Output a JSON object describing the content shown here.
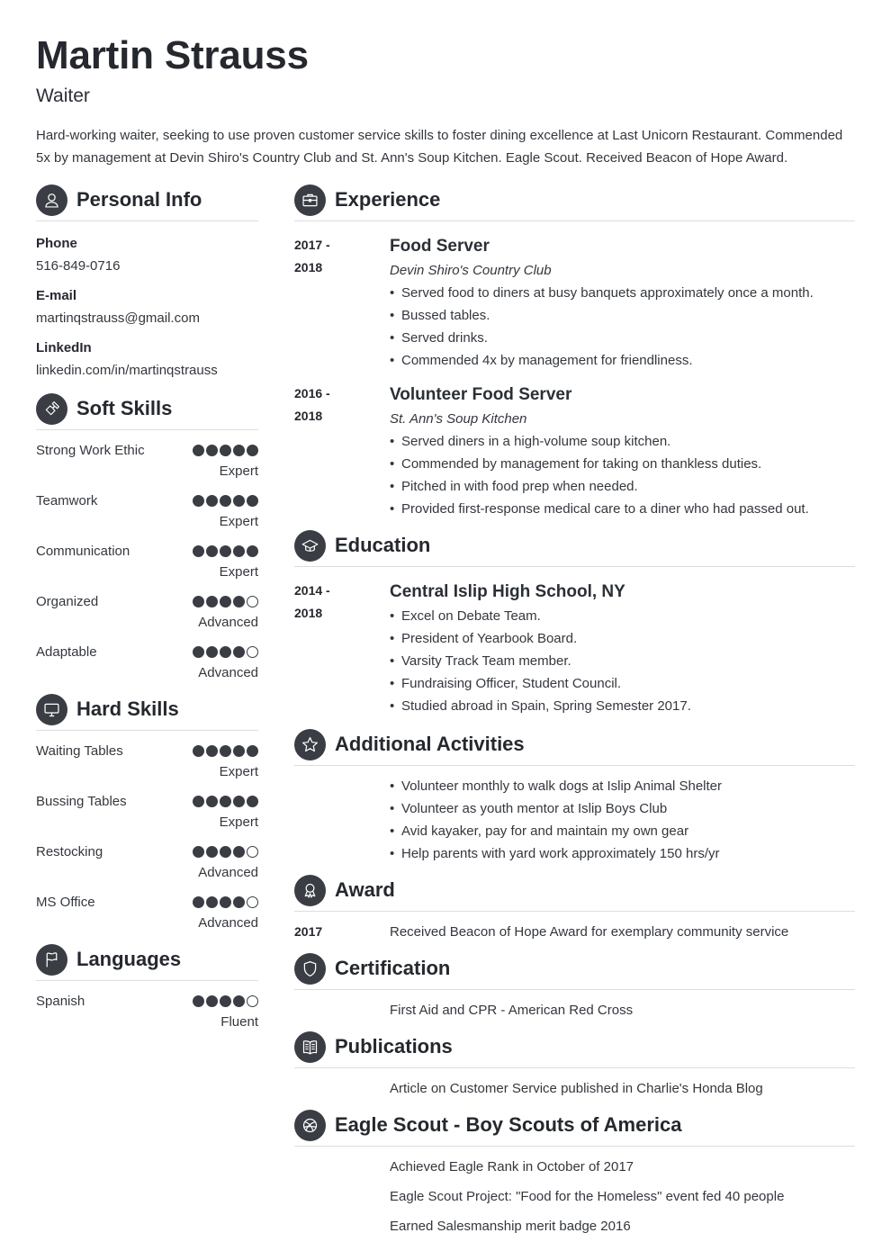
{
  "header": {
    "name": "Martin Strauss",
    "title": "Waiter",
    "summary": "Hard-working waiter, seeking to use proven customer service skills to foster dining excellence at Last Unicorn Restaurant. Commended 5x by management at Devin Shiro's Country Club and St. Ann's Soup Kitchen. Eagle Scout. Received Beacon of Hope Award."
  },
  "personal_info": {
    "heading": "Personal Info",
    "icon": "person-icon",
    "fields": [
      {
        "label": "Phone",
        "value": "516-849-0716"
      },
      {
        "label": "E-mail",
        "value": "martinqstrauss@gmail.com"
      },
      {
        "label": "LinkedIn",
        "value": "linkedin.com/in/martinqstrauss"
      }
    ]
  },
  "soft_skills": {
    "heading": "Soft Skills",
    "icon": "puzzle-icon",
    "items": [
      {
        "name": "Strong Work Ethic",
        "rating": 5,
        "max": 5,
        "level": "Expert"
      },
      {
        "name": "Teamwork",
        "rating": 5,
        "max": 5,
        "level": "Expert"
      },
      {
        "name": "Communication",
        "rating": 5,
        "max": 5,
        "level": "Expert"
      },
      {
        "name": "Organized",
        "rating": 4,
        "max": 5,
        "level": "Advanced"
      },
      {
        "name": "Adaptable",
        "rating": 4,
        "max": 5,
        "level": "Advanced"
      }
    ]
  },
  "hard_skills": {
    "heading": "Hard Skills",
    "icon": "monitor-icon",
    "items": [
      {
        "name": "Waiting Tables",
        "rating": 5,
        "max": 5,
        "level": "Expert"
      },
      {
        "name": "Bussing Tables",
        "rating": 5,
        "max": 5,
        "level": "Expert"
      },
      {
        "name": "Restocking",
        "rating": 4,
        "max": 5,
        "level": "Advanced"
      },
      {
        "name": "MS Office",
        "rating": 4,
        "max": 5,
        "level": "Advanced"
      }
    ]
  },
  "languages": {
    "heading": "Languages",
    "icon": "flag-icon",
    "items": [
      {
        "name": "Spanish",
        "rating": 4,
        "max": 5,
        "level": "Fluent"
      }
    ]
  },
  "experience": {
    "heading": "Experience",
    "icon": "briefcase-icon",
    "entries": [
      {
        "date_start": "2017 -",
        "date_end": "2018",
        "title": "Food Server",
        "company": "Devin Shiro's Country Club",
        "bullets": [
          "Served food to diners at busy banquets approximately once a month.",
          "Bussed tables.",
          "Served drinks.",
          "Commended 4x by management for friendliness."
        ]
      },
      {
        "date_start": "2016 -",
        "date_end": "2018",
        "title": "Volunteer Food Server",
        "company": "St. Ann's Soup Kitchen",
        "bullets": [
          "Served diners in a high-volume soup kitchen.",
          "Commended by management for taking on thankless duties.",
          "Pitched in with food prep when needed.",
          "Provided first-response medical care to a diner who had passed out."
        ]
      }
    ]
  },
  "education": {
    "heading": "Education",
    "icon": "graduation-cap-icon",
    "entries": [
      {
        "date_start": "2014 -",
        "date_end": "2018",
        "title": "Central Islip High School, NY",
        "bullets": [
          "Excel on Debate Team.",
          "President of Yearbook Board.",
          "Varsity Track Team member.",
          "Fundraising Officer, Student Council.",
          "Studied abroad in Spain, Spring Semester 2017."
        ]
      }
    ]
  },
  "activities": {
    "heading": "Additional Activities",
    "icon": "star-icon",
    "bullets": [
      "Volunteer monthly to walk dogs at Islip Animal Shelter",
      "Volunteer as youth mentor at Islip Boys Club",
      "Avid kayaker, pay for and maintain my own gear",
      "Help parents with yard work approximately 150 hrs/yr"
    ]
  },
  "award": {
    "heading": "Award",
    "icon": "award-ribbon-icon",
    "date": "2017",
    "text": "Received Beacon of Hope Award for exemplary community service"
  },
  "certification": {
    "heading": "Certification",
    "icon": "shield-icon",
    "text": "First Aid and CPR - American Red Cross"
  },
  "publications": {
    "heading": "Publications",
    "icon": "book-icon",
    "text": "Article on Customer Service published in Charlie's Honda Blog"
  },
  "eagle_scout": {
    "heading": "Eagle Scout - Boy Scouts of America",
    "icon": "ball-icon",
    "lines": [
      "Achieved Eagle Rank in October of 2017",
      "Eagle Scout Project: \"Food for the Homeless\" event fed 40 people",
      "Earned Salesmanship merit badge 2016"
    ]
  }
}
